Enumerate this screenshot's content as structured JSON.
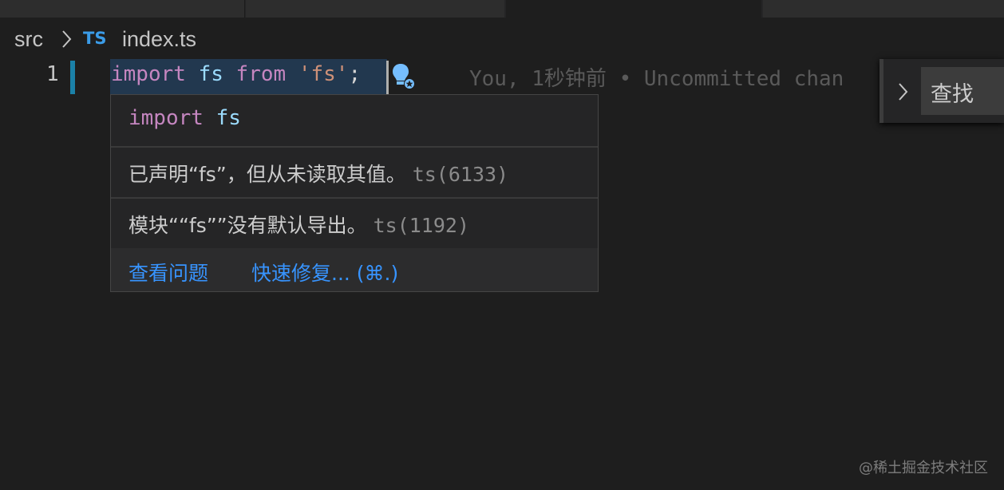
{
  "breadcrumb": {
    "folder": "src",
    "file_type_badge": "TS",
    "file": "index.ts"
  },
  "editor": {
    "line_number": "1",
    "code": {
      "kw_import": "import",
      "id_fs": "fs",
      "kw_from": "from",
      "str_fs": "'fs'",
      "semicolon": ";"
    },
    "blame": "You, 1秒钟前 • Uncommitted chan"
  },
  "find_widget": {
    "expand_icon": "chevron-right-icon",
    "input_value": "查找"
  },
  "hover": {
    "signature": {
      "keyword": "import",
      "identifier": "fs"
    },
    "diagnostics": [
      {
        "message": "已声明“fs”，但从未读取其值。",
        "code": "ts(6133)"
      },
      {
        "message": "模块““fs””没有默认导出。",
        "code": "ts(1192)"
      }
    ],
    "actions": {
      "view_problem": "查看问题",
      "quick_fix": "快速修复... (⌘.)"
    }
  },
  "watermark": "@稀土掘金技术社区",
  "colors": {
    "background": "#1e1e1e",
    "keyword": "#c586c0",
    "identifier": "#9cdcfe",
    "string": "#ce9178",
    "link": "#3794ff",
    "ts_badge": "#3b9ce8",
    "error_squiggle": "#f14c4c"
  },
  "icons": {
    "breadcrumb_separator": "chevron-right-icon",
    "lightbulb": "lightbulb-autofix-icon"
  }
}
